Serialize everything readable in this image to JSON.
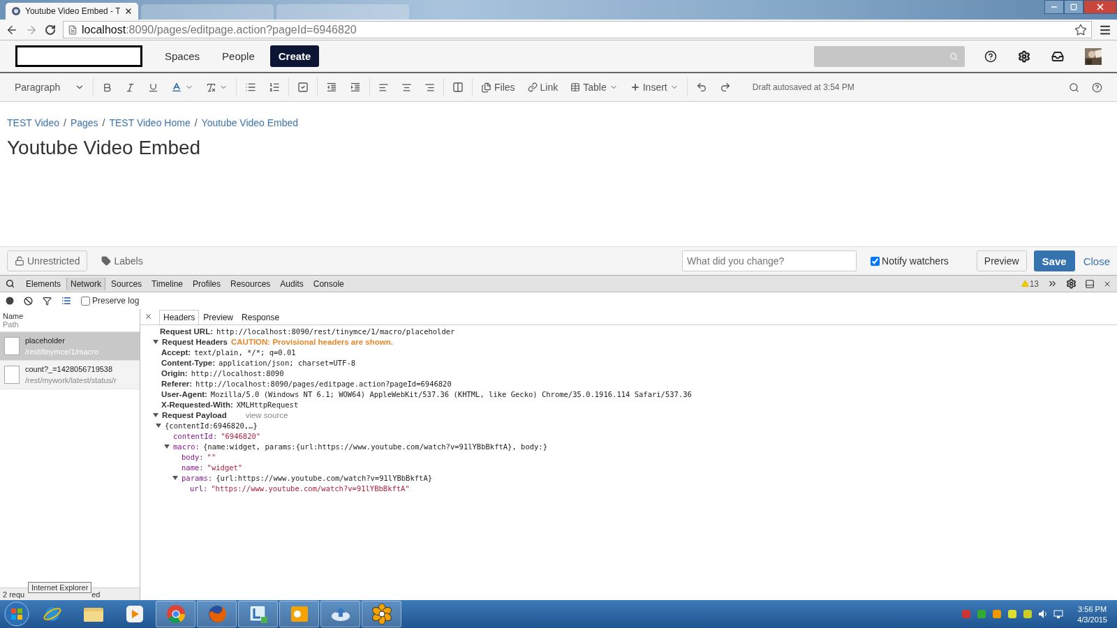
{
  "browser": {
    "tabs": [
      {
        "title": "Youtube Video Embed - T",
        "selected": true
      },
      {
        "selected": false
      },
      {
        "selected": false
      }
    ],
    "url_host": "localhost",
    "url_rest": ":8090/pages/editpage.action?pageId=6946820"
  },
  "header": {
    "nav": [
      {
        "label": "Spaces"
      },
      {
        "label": "People"
      }
    ],
    "create": "Create"
  },
  "toolbar": {
    "style": "Paragraph",
    "files": "Files",
    "link": "Link",
    "table": "Table",
    "insert": "Insert",
    "status": "Draft autosaved at 3:54 PM"
  },
  "breadcrumbs": {
    "separator": "/",
    "items": [
      "TEST Video",
      "Pages",
      "TEST Video Home",
      "Youtube Video Embed"
    ]
  },
  "page_title": "Youtube Video Embed",
  "footer": {
    "restrictions": "Unrestricted",
    "labels": "Labels",
    "comment_placeholder": "What did you change?",
    "notify": {
      "label": "Notify watchers",
      "checked": true
    },
    "preview": "Preview",
    "save": "Save",
    "close": "Close"
  },
  "devtools": {
    "tabs": [
      {
        "label": "Elements",
        "selected": false
      },
      {
        "label": "Network",
        "selected": true
      },
      {
        "label": "Sources",
        "selected": false
      },
      {
        "label": "Timeline",
        "selected": false
      },
      {
        "label": "Profiles",
        "selected": false
      },
      {
        "label": "Resources",
        "selected": false
      },
      {
        "label": "Audits",
        "selected": false
      },
      {
        "label": "Console",
        "selected": false
      }
    ],
    "warnings": "13",
    "preserve_log": {
      "label": "Preserve log",
      "checked": false
    },
    "columns": [
      "Name",
      "Path"
    ],
    "requests": [
      {
        "name": "placeholder",
        "path": "/rest/tinymce/1/macro",
        "selected": true
      },
      {
        "name": "count?_=1428056719538",
        "path": "/rest/mywork/latest/status/r",
        "selected": false
      }
    ],
    "detail_tabs": [
      {
        "label": "Headers",
        "selected": true
      },
      {
        "label": "Preview",
        "selected": false
      },
      {
        "label": "Response",
        "selected": false
      }
    ],
    "request_url": {
      "key": "Request URL:",
      "value": "http://localhost:8090/rest/tinymce/1/macro/placeholder"
    },
    "headers_section": {
      "title": "Request Headers",
      "caution": "CAUTION: Provisional headers are shown.",
      "expanded": true,
      "rows": [
        {
          "key": "Accept:",
          "value": "text/plain, */*; q=0.01"
        },
        {
          "key": "Content-Type:",
          "value": "application/json; charset=UTF-8"
        },
        {
          "key": "Origin:",
          "value": "http://localhost:8090"
        },
        {
          "key": "Referer:",
          "value": "http://localhost:8090/pages/editpage.action?pageId=6946820"
        },
        {
          "key": "User-Agent:",
          "value": "Mozilla/5.0 (Windows NT 6.1; WOW64) AppleWebKit/537.36 (KHTML, like Gecko) Chrome/35.0.1916.114 Safari/537.36"
        },
        {
          "key": "X-Requested-With:",
          "value": "XMLHttpRequest"
        }
      ]
    },
    "payload_section": {
      "title": "Request Payload",
      "view_source": "view source",
      "expanded": true,
      "tree": {
        "value": "{contentId:6946820,…}",
        "expanded": true,
        "children": [
          {
            "key": "contentId:",
            "value": "\"6946820\""
          },
          {
            "key": "macro:",
            "value": "{name:widget, params:{url:https://www.youtube.com/watch?v=91lYBbBkftA}, body:}",
            "expanded": true,
            "children": [
              {
                "key": "body:",
                "value": "\"\""
              },
              {
                "key": "name:",
                "value": "\"widget\""
              },
              {
                "key": "params:",
                "value": "{url:https://www.youtube.com/watch?v=91lYBbBkftA}",
                "expanded": true,
                "children": [
                  {
                    "key": "url:",
                    "value": "\"https://www.youtube.com/watch?v=91lYBbBkftA\""
                  }
                ]
              }
            ]
          }
        ]
      }
    },
    "status_left": "2 requ",
    "status_right": "ed",
    "tooltip": "Internet Explorer"
  },
  "taskbar": {
    "time": "3:56 PM",
    "date": "4/3/2015"
  }
}
